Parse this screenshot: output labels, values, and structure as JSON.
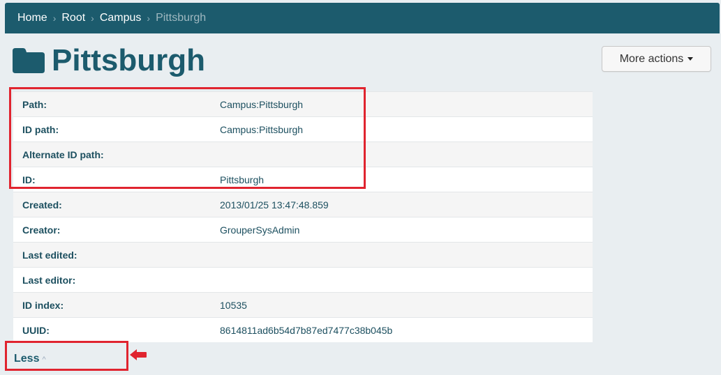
{
  "breadcrumb": {
    "items": [
      "Home",
      "Root",
      "Campus"
    ],
    "current": "Pittsburgh",
    "separator": "›"
  },
  "page": {
    "title": "Pittsburgh",
    "icon": "folder-icon"
  },
  "actions": {
    "more_label": "More actions"
  },
  "details": [
    {
      "label": "Path:",
      "value": "Campus:Pittsburgh"
    },
    {
      "label": "ID path:",
      "value": "Campus:Pittsburgh"
    },
    {
      "label": "Alternate ID path:",
      "value": ""
    },
    {
      "label": "ID:",
      "value": "Pittsburgh"
    },
    {
      "label": "Created:",
      "value": "2013/01/25 13:47:48.859"
    },
    {
      "label": "Creator:",
      "value": "GrouperSysAdmin"
    },
    {
      "label": "Last edited:",
      "value": ""
    },
    {
      "label": "Last editor:",
      "value": ""
    },
    {
      "label": "ID index:",
      "value": "10535"
    },
    {
      "label": "UUID:",
      "value": "8614811ad6b54d7b87ed7477c38b045b"
    }
  ],
  "toggle": {
    "less_label": "Less",
    "chevron": "^"
  },
  "colors": {
    "header_bg": "#1c5b6d",
    "annotation_red": "#e0242f",
    "title": "#1c5b6d"
  }
}
